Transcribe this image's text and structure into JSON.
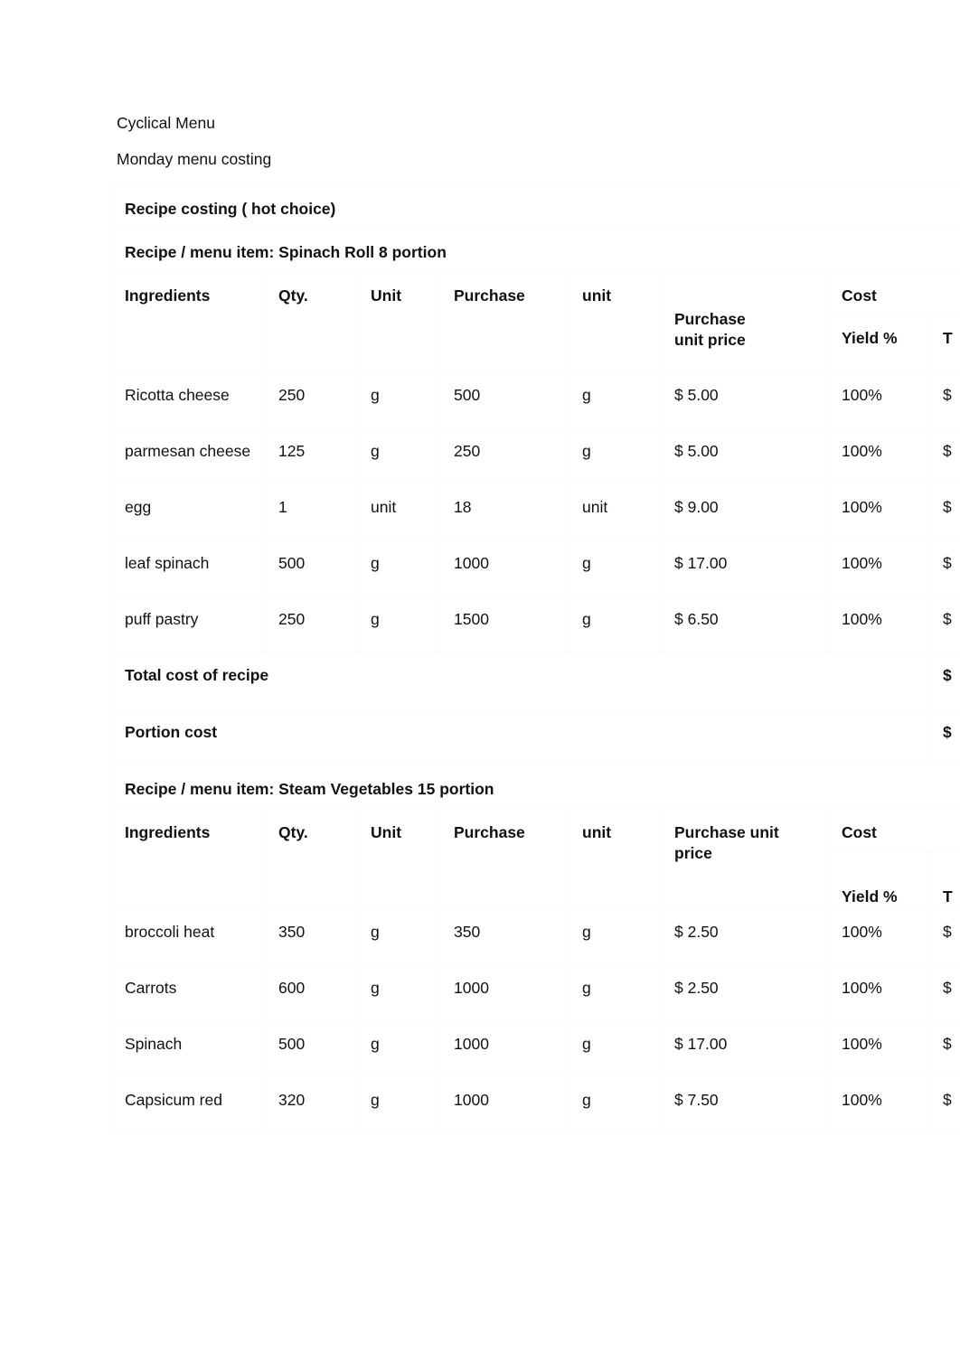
{
  "document": {
    "heading_line_1": "Cyclical Menu",
    "heading_line_2": "Monday menu costing",
    "section_title": "Recipe costing ( hot choice)"
  },
  "recipe_1": {
    "title": "Recipe / menu item: Spinach Roll 8 portion",
    "columns": {
      "ingredients": "Ingredients",
      "qty": "Qty.",
      "unit": "Unit",
      "purchase": "Purchase",
      "purchase_unit": "unit",
      "purchase_unit_price": "Purchase\nunit price",
      "cost": "Cost",
      "yield_pct": "Yield %",
      "total_cost_clipped": "T"
    },
    "rows": [
      {
        "ingredient": "Ricotta cheese",
        "qty": "250",
        "unit": "g",
        "purchase": "500",
        "purchase_unit": "g",
        "purchase_unit_price": "$ 5.00",
        "yield_pct": "100%",
        "total_cost_clipped": "$"
      },
      {
        "ingredient": "parmesan cheese",
        "qty": "125",
        "unit": "g",
        "purchase": "250",
        "purchase_unit": "g",
        "purchase_unit_price": "$ 5.00",
        "yield_pct": "100%",
        "total_cost_clipped": "$"
      },
      {
        "ingredient": "egg",
        "qty": "1",
        "unit": "unit",
        "purchase": "18",
        "purchase_unit": "unit",
        "purchase_unit_price": "$ 9.00",
        "yield_pct": "100%",
        "total_cost_clipped": "$"
      },
      {
        "ingredient": "leaf spinach",
        "qty": "500",
        "unit": "g",
        "purchase": "1000",
        "purchase_unit": "g",
        "purchase_unit_price": "$ 17.00",
        "yield_pct": "100%",
        "total_cost_clipped": "$"
      },
      {
        "ingredient": "puff pastry",
        "qty": "250",
        "unit": "g",
        "purchase": "1500",
        "purchase_unit": "g",
        "purchase_unit_price": "$ 6.50",
        "yield_pct": "100%",
        "total_cost_clipped": "$"
      }
    ],
    "total_cost_label": "Total cost of recipe",
    "total_cost_value_clipped": "$",
    "portion_cost_label": "Portion cost",
    "portion_cost_value_clipped": "$"
  },
  "recipe_2": {
    "title": "Recipe / menu item: Steam Vegetables 15 portion",
    "columns": {
      "ingredients": "Ingredients",
      "qty": "Qty.",
      "unit": "Unit",
      "purchase": "Purchase",
      "purchase_unit": "unit",
      "purchase_unit_price": "Purchase unit\nprice",
      "cost": "Cost",
      "yield_pct": "Yield %",
      "total_cost_clipped": "T"
    },
    "rows": [
      {
        "ingredient": "broccoli heat",
        "qty": "350",
        "unit": "g",
        "purchase": "350",
        "purchase_unit": "g",
        "purchase_unit_price": "$ 2.50",
        "yield_pct": "100%",
        "total_cost_clipped": "$"
      },
      {
        "ingredient": "Carrots",
        "qty": "600",
        "unit": "g",
        "purchase": "1000",
        "purchase_unit": "g",
        "purchase_unit_price": "$ 2.50",
        "yield_pct": "100%",
        "total_cost_clipped": "$"
      },
      {
        "ingredient": "Spinach",
        "qty": "500",
        "unit": "g",
        "purchase": "1000",
        "purchase_unit": "g",
        "purchase_unit_price": "$ 17.00",
        "yield_pct": "100%",
        "total_cost_clipped": "$"
      },
      {
        "ingredient": "Capsicum red",
        "qty": "320",
        "unit": "g",
        "purchase": "1000",
        "purchase_unit": "g",
        "purchase_unit_price": "$ 7.50",
        "yield_pct": "100%",
        "total_cost_clipped": "$"
      }
    ]
  }
}
